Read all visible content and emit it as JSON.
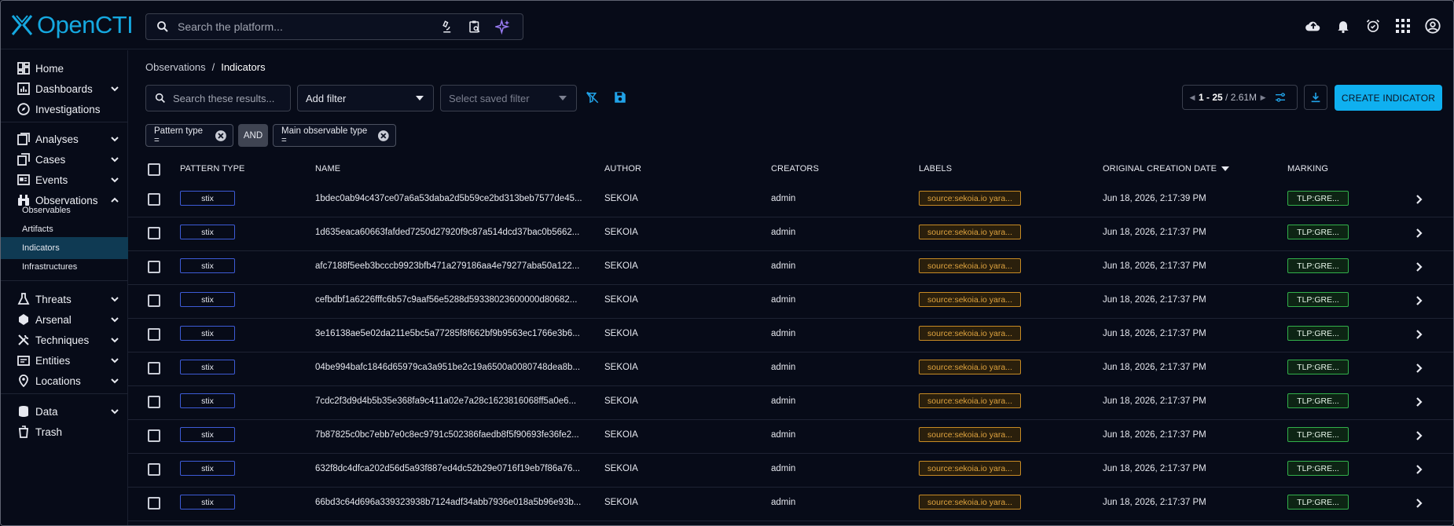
{
  "app": {
    "name": "OpenCTI"
  },
  "search": {
    "placeholder": "Search the platform..."
  },
  "sidebar": {
    "items": [
      {
        "label": "Home",
        "icon": "dashboard-grid-icon"
      },
      {
        "label": "Dashboards",
        "icon": "bar-chart-icon"
      },
      {
        "label": "Investigations",
        "icon": "compass-icon"
      },
      {
        "label": "Analyses",
        "icon": "analyses-icon"
      },
      {
        "label": "Cases",
        "icon": "cases-icon"
      },
      {
        "label": "Events",
        "icon": "events-icon"
      },
      {
        "label": "Observations",
        "icon": "binoculars-icon"
      },
      {
        "label": "Threats",
        "icon": "flask-icon"
      },
      {
        "label": "Arsenal",
        "icon": "arsenal-icon"
      },
      {
        "label": "Techniques",
        "icon": "tools-icon"
      },
      {
        "label": "Entities",
        "icon": "entities-icon"
      },
      {
        "label": "Locations",
        "icon": "location-pin-icon"
      },
      {
        "label": "Data",
        "icon": "database-icon"
      },
      {
        "label": "Trash",
        "icon": "trash-icon"
      }
    ],
    "observations_sub": [
      "Observables",
      "Artifacts",
      "Indicators",
      "Infrastructures"
    ]
  },
  "breadcrumb": {
    "parent": "Observations",
    "separator": "/",
    "current": "Indicators"
  },
  "toolbar": {
    "search_placeholder": "Search these results...",
    "add_filter": "Add filter",
    "saved_filter_placeholder": "Select saved filter",
    "pager": {
      "range": "1 - 25",
      "total": " / 2.61M"
    },
    "create_label": "CREATE INDICATOR"
  },
  "filters": {
    "chip1": "Pattern type =",
    "operator": "AND",
    "chip2": "Main observable type ="
  },
  "table": {
    "headers": {
      "pattern_type": "PATTERN TYPE",
      "name": "NAME",
      "author": "AUTHOR",
      "creators": "CREATORS",
      "labels": "LABELS",
      "created": "ORIGINAL CREATION DATE",
      "marking": "MARKING"
    },
    "rows": [
      {
        "pattern": "stix",
        "name": "1bdec0ab94c437ce07a6a53daba2d5b59ce2bd313beb7577de45...",
        "author": "SEKOIA",
        "creator": "admin",
        "label": "source:sekoia.io yara...",
        "date": "Jun 18, 2026, 2:17:39 PM",
        "marking": "TLP:GRE..."
      },
      {
        "pattern": "stix",
        "name": "1d635eaca60663fafded7250d27920f9c87a514dcd37bac0b5662...",
        "author": "SEKOIA",
        "creator": "admin",
        "label": "source:sekoia.io yara...",
        "date": "Jun 18, 2026, 2:17:37 PM",
        "marking": "TLP:GRE..."
      },
      {
        "pattern": "stix",
        "name": "afc7188f5eeb3bcccb9923bfb471a279186aa4e79277aba50a122...",
        "author": "SEKOIA",
        "creator": "admin",
        "label": "source:sekoia.io yara...",
        "date": "Jun 18, 2026, 2:17:37 PM",
        "marking": "TLP:GRE..."
      },
      {
        "pattern": "stix",
        "name": "cefbdbf1a6226fffc6b57c9aaf56e5288d59338023600000d80682...",
        "author": "SEKOIA",
        "creator": "admin",
        "label": "source:sekoia.io yara...",
        "date": "Jun 18, 2026, 2:17:37 PM",
        "marking": "TLP:GRE..."
      },
      {
        "pattern": "stix",
        "name": "3e16138ae5e02da211e5bc5a77285f8f662bf9b9563ec1766e3b6...",
        "author": "SEKOIA",
        "creator": "admin",
        "label": "source:sekoia.io yara...",
        "date": "Jun 18, 2026, 2:17:37 PM",
        "marking": "TLP:GRE..."
      },
      {
        "pattern": "stix",
        "name": "04be994bafc1846d65979ca3a951be2c19a6500a0080748dea8b...",
        "author": "SEKOIA",
        "creator": "admin",
        "label": "source:sekoia.io yara...",
        "date": "Jun 18, 2026, 2:17:37 PM",
        "marking": "TLP:GRE..."
      },
      {
        "pattern": "stix",
        "name": "7cdc2f3d9d4b5b35e368fa9c411a02e7a28c1623816068ff5a0e6...",
        "author": "SEKOIA",
        "creator": "admin",
        "label": "source:sekoia.io yara...",
        "date": "Jun 18, 2026, 2:17:37 PM",
        "marking": "TLP:GRE..."
      },
      {
        "pattern": "stix",
        "name": "7b87825c0bc7ebb7e0c8ec9791c502386faedb8f5f90693fe36fe2...",
        "author": "SEKOIA",
        "creator": "admin",
        "label": "source:sekoia.io yara...",
        "date": "Jun 18, 2026, 2:17:37 PM",
        "marking": "TLP:GRE..."
      },
      {
        "pattern": "stix",
        "name": "632f8dc4dfca202d56d5a93f887ed4dc52b29e0716f19eb7f86a76...",
        "author": "SEKOIA",
        "creator": "admin",
        "label": "source:sekoia.io yara...",
        "date": "Jun 18, 2026, 2:17:37 PM",
        "marking": "TLP:GRE..."
      },
      {
        "pattern": "stix",
        "name": "66bd3c64d696a339323938b7124adf34abb7936e018a5b96e93b...",
        "author": "SEKOIA",
        "creator": "admin",
        "label": "source:sekoia.io yara...",
        "date": "Jun 18, 2026, 2:17:37 PM",
        "marking": "TLP:GRE..."
      }
    ]
  },
  "colors": {
    "accent": "#0fb0f0",
    "label_orange": "#e0a43f",
    "tlp_green": "#32b04a",
    "pill_blue": "#3d5bd6"
  }
}
